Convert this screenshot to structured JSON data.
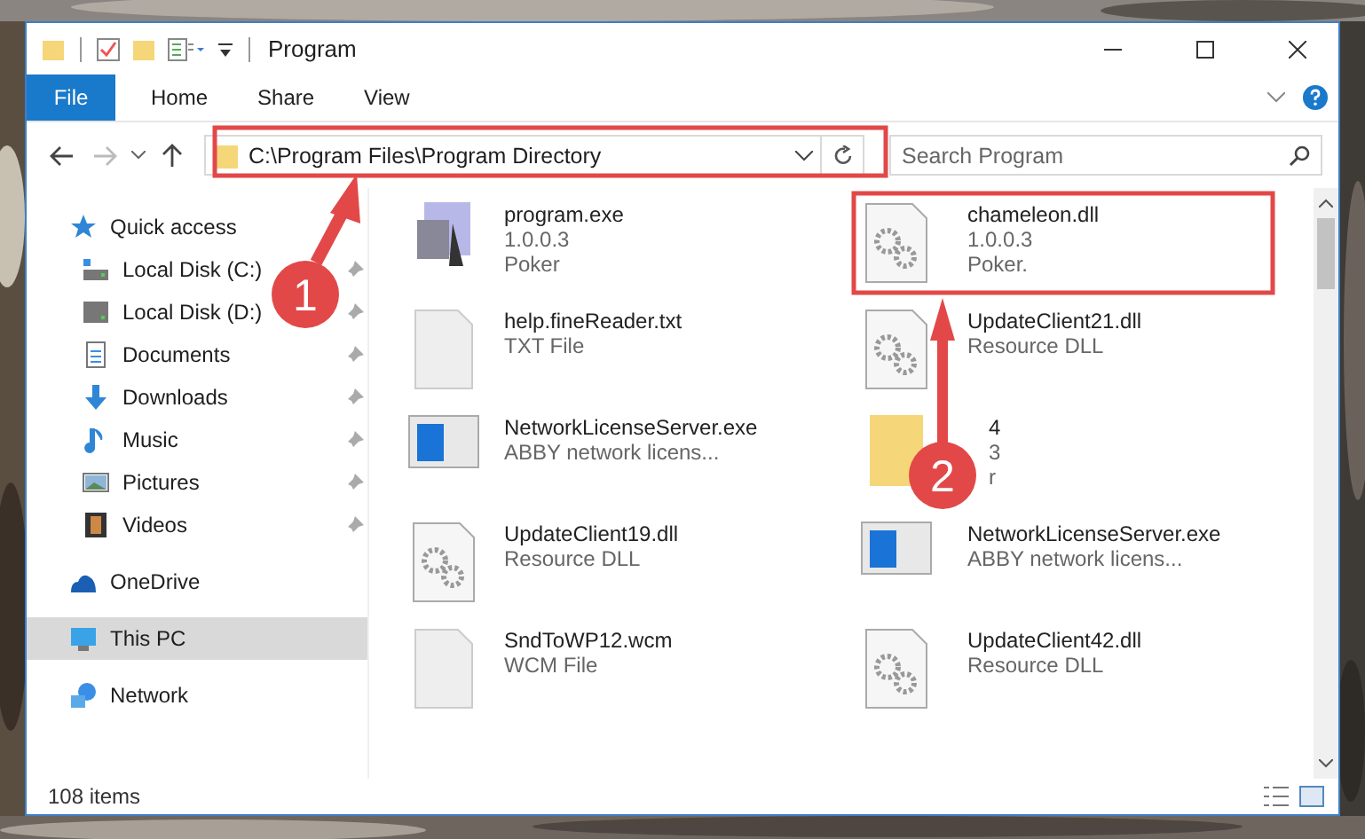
{
  "window": {
    "title": "Program"
  },
  "ribbon_tabs": [
    {
      "label": "File",
      "selected": true
    },
    {
      "label": "Home",
      "selected": false
    },
    {
      "label": "Share",
      "selected": false
    },
    {
      "label": "View",
      "selected": false
    }
  ],
  "address": {
    "path": "C:\\Program Files\\Program Directory"
  },
  "search": {
    "placeholder": "Search Program"
  },
  "sidebar": {
    "items": [
      {
        "label": "Quick access",
        "selected": false,
        "children": [
          {
            "label": "Local Disk (C:)",
            "pinned": true,
            "selected": false
          },
          {
            "label": "Local Disk (D:)",
            "pinned": true,
            "selected": false
          },
          {
            "label": "Documents",
            "pinned": true,
            "selected": false
          },
          {
            "label": "Downloads",
            "pinned": true,
            "selected": false
          },
          {
            "label": "Music",
            "pinned": true,
            "selected": false
          },
          {
            "label": "Pictures",
            "pinned": true,
            "selected": false
          },
          {
            "label": "Videos",
            "pinned": true,
            "selected": false
          }
        ]
      },
      {
        "label": "OneDrive",
        "selected": false
      },
      {
        "label": "This PC",
        "selected": true
      },
      {
        "label": "Network",
        "selected": false
      }
    ]
  },
  "files": [
    {
      "kind": "exe",
      "name": "program.exe",
      "lines": [
        "1.0.0.3",
        "Poker"
      ]
    },
    {
      "kind": "dll",
      "name": "chameleon.dll",
      "lines": [
        "1.0.0.3",
        "Poker."
      ]
    },
    {
      "kind": "txt",
      "name": "help.fineReader.txt",
      "lines": [
        "TXT File"
      ]
    },
    {
      "kind": "dll",
      "name": "UpdateClient21.dll",
      "lines": [
        "Resource DLL"
      ]
    },
    {
      "kind": "window",
      "name": "NetworkLicenseServer.exe",
      "lines": [
        "ABBY network licens..."
      ]
    },
    {
      "kind": "folder",
      "name": "4",
      "lines": [
        "3",
        "r"
      ]
    },
    {
      "kind": "dll",
      "name": "UpdateClient19.dll",
      "lines": [
        "Resource DLL"
      ]
    },
    {
      "kind": "window",
      "name": "NetworkLicenseServer.exe",
      "lines": [
        "ABBY network licens..."
      ]
    },
    {
      "kind": "txt",
      "name": "SndToWP12.wcm",
      "lines": [
        "WCM File"
      ]
    },
    {
      "kind": "dll",
      "name": "UpdateClient42.dll",
      "lines": [
        "Resource DLL"
      ]
    }
  ],
  "status_bar": {
    "count": "108 items"
  },
  "annotations": [
    {
      "label": "1"
    },
    {
      "label": "2"
    }
  ]
}
